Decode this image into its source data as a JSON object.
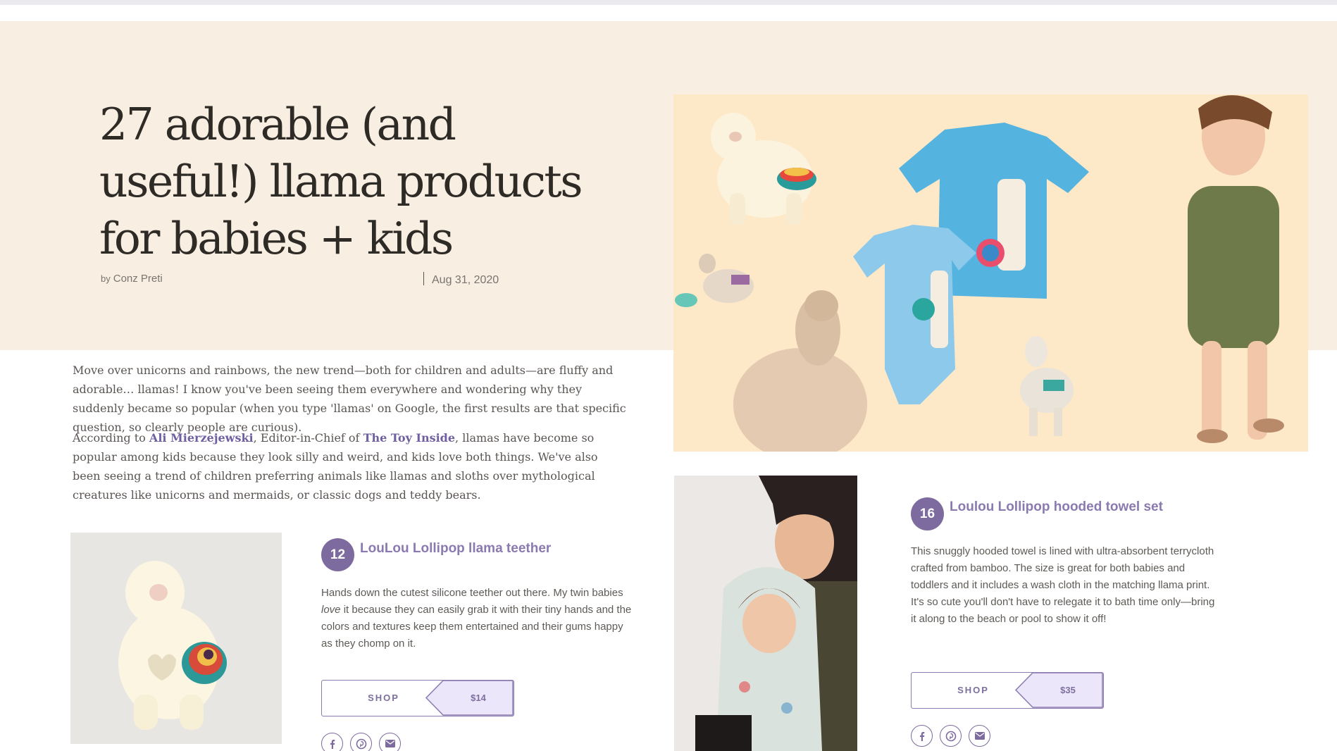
{
  "article": {
    "title": "27 adorable (and useful!) llama products for babies + kids",
    "byline_prefix": "by",
    "author": "Conz Preti",
    "date": "Aug 31, 2020"
  },
  "intro": {
    "p1": "Move over unicorns and rainbows, the new trend—both for children and adults—are fluffy and adorable… llamas! I know you've been seeing them everywhere and wondering why they suddenly became so popular (when you type 'llamas' on Google, the first results are that specific question, so clearly people are curious).",
    "p2_before": "According to ",
    "p2_link1": "Ali Mierzejewski",
    "p2_mid": ", Editor-in-Chief of ",
    "p2_link2": "The Toy Inside",
    "p2_after": ", llamas have become so popular among kids because they look silly and weird, and kids love both things. We've also been seeing a trend of children preferring animals like llamas and sloths over mythological creatures like unicorns and mermaids, or classic dogs and teddy bears."
  },
  "products": [
    {
      "number": "12",
      "title": "LouLou Lollipop llama teether",
      "desc_before": "Hands down the cutest silicone teether out there. My twin babies ",
      "desc_em": "love",
      "desc_after": " it because they can easily grab it with their tiny hands and the colors and textures keep them entertained and their gums happy as they chomp on it.",
      "shop_label": "SHOP",
      "price": "$14"
    },
    {
      "number": "16",
      "title": "Loulou Lollipop hooded towel set",
      "desc": "This snuggly hooded towel is lined with ultra-absorbent terrycloth crafted from bamboo. The size is great for both babies and toddlers and it includes a wash cloth in the matching llama print. It's so cute you'll don't have to relegate it to bath time only—bring it along to the beach or pool to show it off!",
      "shop_label": "SHOP",
      "price": "$35"
    }
  ],
  "icons": [
    "facebook-icon",
    "pinterest-icon",
    "email-icon"
  ],
  "colors": {
    "accent": "#7d6a9e",
    "hero_bg": "#f8eee2",
    "price_bg": "#ece6fb"
  }
}
